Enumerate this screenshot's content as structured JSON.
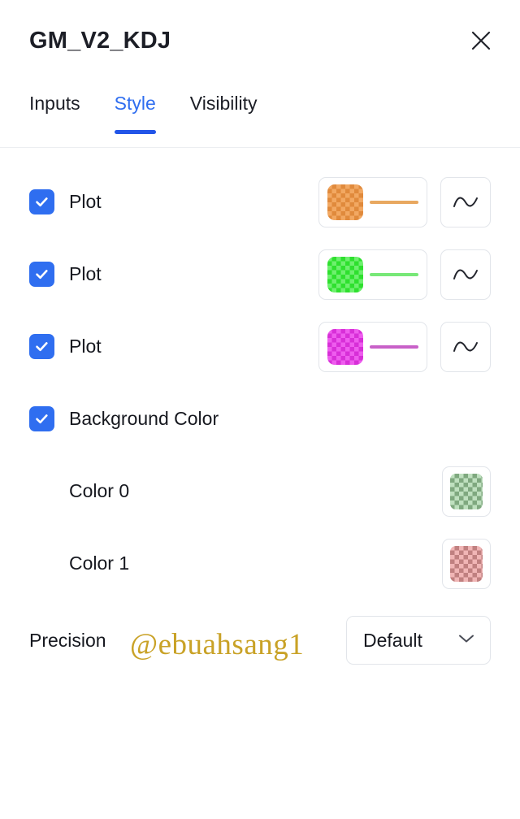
{
  "header": {
    "title": "GM_V2_KDJ",
    "close_icon": "close-icon"
  },
  "tabs": [
    {
      "label": "Inputs",
      "active": false
    },
    {
      "label": "Style",
      "active": true
    },
    {
      "label": "Visibility",
      "active": false
    }
  ],
  "style_rows": [
    {
      "label": "Plot",
      "checked": true,
      "swatch_light": "#f2a862",
      "swatch_dark": "#e08a3c",
      "line_color": "#e8a860",
      "wave_icon": "wave-line-icon"
    },
    {
      "label": "Plot",
      "checked": true,
      "swatch_light": "#6ef06e",
      "swatch_dark": "#2ee02e",
      "line_color": "#78e878",
      "wave_icon": "wave-line-icon"
    },
    {
      "label": "Plot",
      "checked": true,
      "swatch_light": "#ee5cee",
      "swatch_dark": "#d82fd8",
      "line_color": "#c860c8",
      "wave_icon": "wave-line-icon"
    }
  ],
  "background": {
    "label": "Background Color",
    "checked": true,
    "colors": [
      {
        "label": "Color 0",
        "swatch_light": "#bfe0bf",
        "swatch_dark": "#7fa87f"
      },
      {
        "label": "Color 1",
        "swatch_light": "#f0b5b5",
        "swatch_dark": "#c08080"
      }
    ]
  },
  "precision": {
    "label": "Precision",
    "value": "Default",
    "chevron_icon": "chevron-down-icon"
  },
  "watermark": "@ebuahsang1",
  "theme": {
    "accent": "#2f6ef0",
    "tab_underline": "#2255e8",
    "text": "#16181f",
    "border": "#e2e5ea",
    "watermark_color": "#c9a227"
  }
}
